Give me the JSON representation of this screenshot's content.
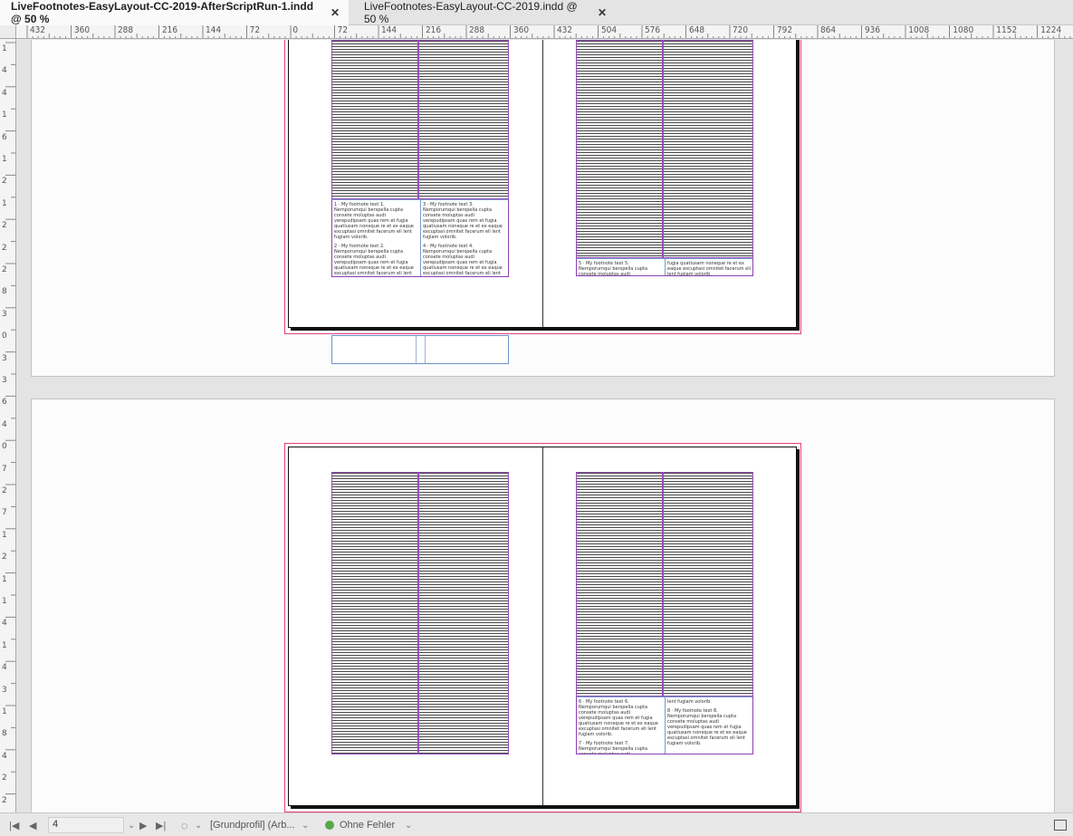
{
  "tabs": [
    {
      "label": "LiveFootnotes-EasyLayout-CC-2019-AfterScriptRun-1.indd @ 50 %",
      "active": true
    },
    {
      "label": "LiveFootnotes-EasyLayout-CC-2019.indd @ 50 %",
      "active": false
    }
  ],
  "icons": {
    "close": "close-icon",
    "first": "first-page-icon",
    "prev": "prev-page-icon",
    "next": "next-page-icon",
    "last": "last-page-icon",
    "preflight": "preflight-icon",
    "panel": "panel-toggle-icon"
  },
  "ruler": {
    "h_labels": [
      "432",
      "360",
      "288",
      "216",
      "144",
      "72",
      "0",
      "72",
      "144",
      "216",
      "288",
      "360",
      "432",
      "504",
      "576",
      "648",
      "720",
      "792",
      "864",
      "936",
      "1008",
      "1080",
      "1152",
      "1224"
    ],
    "v_labels": [
      "1",
      "4",
      "4",
      "1",
      "6",
      "1",
      "2",
      "1",
      "2",
      "2",
      "2",
      "8",
      "3",
      "0",
      "3",
      "3",
      "6",
      "4",
      "0",
      "7",
      "2",
      "7",
      "1",
      "2",
      "1",
      "1",
      "4",
      "1",
      "4",
      "3",
      "1",
      "8",
      "4",
      "2",
      "2"
    ]
  },
  "footnotes": {
    "fn1": "1 · My footnote text 1. Nemporumqui berspella cupta consete moluptas audi verepudipsam quas rem et fugia quatiusam noneque re et ex eaque excuptasi omnitet facerum eli lent fugiam volorib.",
    "fn2": "2 · My footnote text 2. Nemporumqui berspella cupta consete moluptas audi verepudipsam quas rem et fugia quatiusam noneque re et ex eaque excuptasi omnitet facerum eli lent fugiam volorib.",
    "fn3": "3 · My footnote text 3. Nemporumqui berspella cupta consete moluptas audi verepudipsam quas rem et fugia quatiusam noneque re et ex eaque excuptasi omnitet facerum eli lent fugiam volorib.",
    "fn4": "4 · My footnote text 4. Nemporumqui berspella cupta consete moluptas audi verepudipsam quas rem et fugia quatiusam noneque re et ex eaque excuptasi omnitet facerum eli lent fugiam volorib.",
    "fn5": "5 · My footnote text 5. Nemporumqui berspella cupta consete moluptas audi verepudipsam quas rem et",
    "fn5b": "fugia quatiusam noneque re et ex eaque excuptasi omnitet facerum eli lent fugiam volorib.",
    "fn6": "6 · My footnote text 6. Nemporumqui berspella cupta consete moluptas audi verepudipsam quas rem et fugia quatiusam noneque re et ex eaque excuptasi omnitet facerum eli lent fugiam volorib.",
    "fn7": "7 · My footnote text 7. Nemporumqui berspella cupta consete moluptas audi verepudipsam quas rem et",
    "fn7b": "lent fugiam volorib.",
    "fn8": "8 · My footnote text 8. Nemporumqui berspella cupta consete moluptas audi verepudipsam quas rem et fugia quatiusam noneque re et ex eaque excuptasi omnitet facerum eli lent fugiam volorib."
  },
  "status": {
    "page": "4",
    "profile": "[Grundprofil] (Arb...",
    "errors": "Ohne Fehler"
  },
  "colors": {
    "margin_guide": "#e4407a",
    "column_guide": "#8e3fb4",
    "footnote_rule": "#7a9ccf",
    "ok": "#5aa64a"
  }
}
